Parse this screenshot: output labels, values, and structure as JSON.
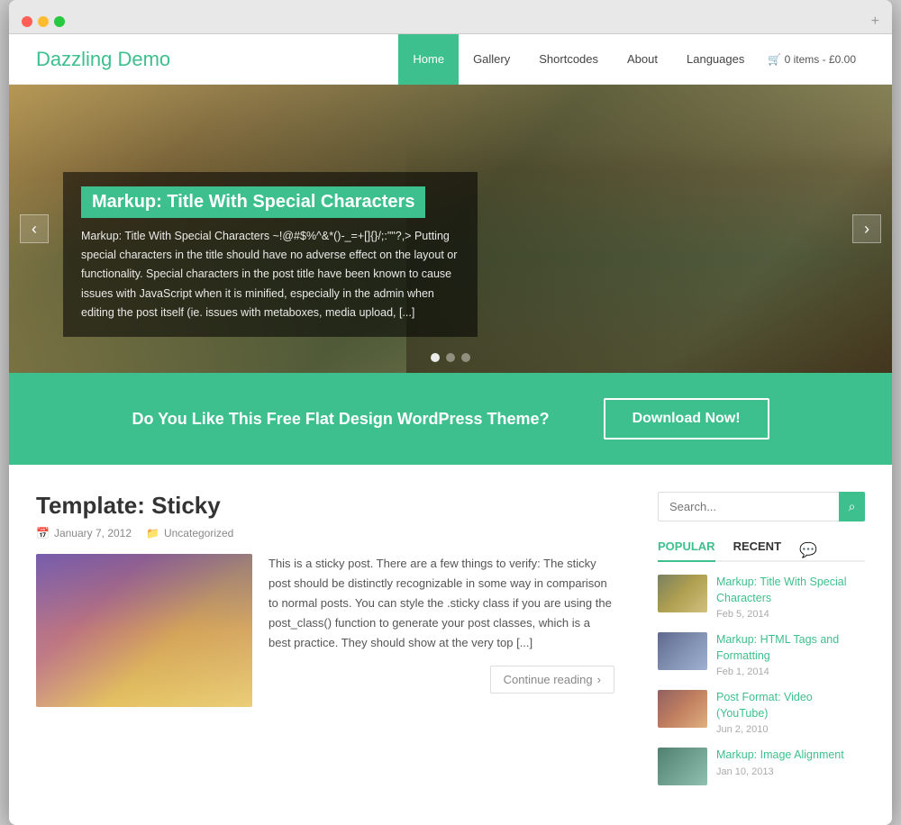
{
  "browser": {
    "expand_icon": "+"
  },
  "header": {
    "logo": "Dazzling Demo",
    "nav_items": [
      {
        "label": "Home",
        "active": true
      },
      {
        "label": "Gallery",
        "active": false
      },
      {
        "label": "Shortcodes",
        "active": false
      },
      {
        "label": "About",
        "active": false,
        "has_dropdown": true
      },
      {
        "label": "Languages",
        "active": false
      }
    ],
    "cart": "🛒 0 items - £0.00"
  },
  "hero": {
    "title": "Markup: Title With Special Characters",
    "excerpt": "Markup: Title With Special Characters ~!@#$%^&*()-_=+[]{}/;:\"\"?,> Putting special characters in the title should have no adverse effect on the layout or functionality. Special characters in the post title have been known to cause issues with JavaScript when it is minified, especially in the admin when editing the post itself (ie. issues with metaboxes, media upload, [...]",
    "arrow_left": "‹",
    "arrow_right": "›",
    "dots": [
      true,
      false,
      false
    ]
  },
  "cta": {
    "text": "Do You Like This Free Flat Design WordPress Theme?",
    "button": "Download Now!"
  },
  "post": {
    "title": "Template: Sticky",
    "date": "January 7, 2012",
    "category": "Uncategorized",
    "excerpt": "This is a sticky post. There are a few things to verify: The sticky post should be distinctly recognizable in some way in comparison to normal posts. You can style the .sticky class if you are using the post_class() function to generate your post classes, which is a best practice. They should show at the very top [...]",
    "continue_label": "Continue reading",
    "continue_arrow": "›"
  },
  "sidebar": {
    "search_placeholder": "Search...",
    "search_icon": "🔍",
    "tabs": [
      {
        "label": "POPULAR",
        "active": true
      },
      {
        "label": "RECENT",
        "active": false
      }
    ],
    "comment_icon": "💬",
    "posts": [
      {
        "title": "Markup: Title With Special Characters",
        "date": "Feb 5, 2014",
        "thumb_class": "sidebar-thumb-1"
      },
      {
        "title": "Markup: HTML Tags and Formatting",
        "date": "Feb 1, 2014",
        "thumb_class": "sidebar-thumb-2"
      },
      {
        "title": "Post Format: Video (YouTube)",
        "date": "Jun 2, 2010",
        "thumb_class": "sidebar-thumb-3"
      },
      {
        "title": "Markup: Image Alignment",
        "date": "Jan 10, 2013",
        "thumb_class": "sidebar-thumb-4"
      }
    ]
  }
}
